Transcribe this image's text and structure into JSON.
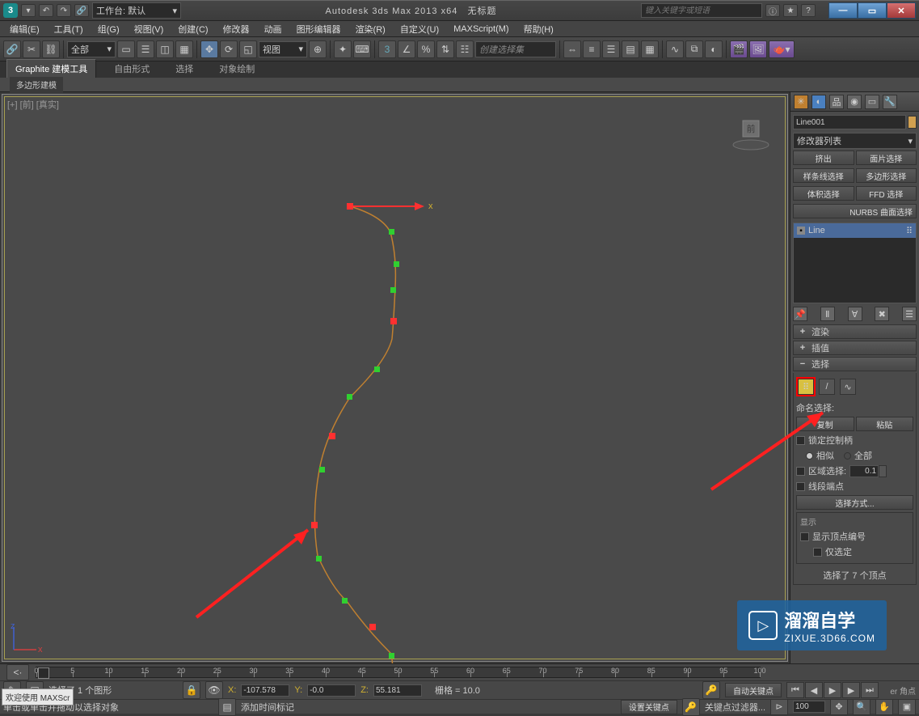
{
  "titlebar": {
    "app_title": "Autodesk 3ds Max  2013 x64",
    "document": "无标题",
    "search_placeholder": "键入关键字或短语",
    "workspace_label": "工作台: 默认"
  },
  "menu": {
    "edit": "编辑(E)",
    "tools": "工具(T)",
    "group": "组(G)",
    "view": "视图(V)",
    "create": "创建(C)",
    "modifiers": "修改器",
    "anim": "动画",
    "graph": "图形编辑器",
    "render": "渲染(R)",
    "custom": "自定义(U)",
    "maxscript": "MAXScript(M)",
    "help": "帮助(H)"
  },
  "toolbar": {
    "all_label": "全部",
    "view_label": "视图",
    "create_set": "创建选择集"
  },
  "ribbon": {
    "tab_graphite": "Graphite 建模工具",
    "tab_free": "自由形式",
    "tab_select": "选择",
    "tab_paint": "对象绘制",
    "sub_poly": "多边形建模"
  },
  "viewport": {
    "label": "[+] [前] [真实]",
    "axis_x": "x",
    "gizmo_x": "x",
    "gizmo_z": "z",
    "cube": "前"
  },
  "side": {
    "object_name": "Line001",
    "modifier_list": "修改器列表",
    "btn_extrude": "挤出",
    "btn_face": "面片选择",
    "btn_spline": "样条线选择",
    "btn_poly": "多边形选择",
    "btn_vol": "体积选择",
    "btn_ffd": "FFD 选择",
    "btn_nurbs": "NURBS 曲面选择",
    "stack_line": "Line",
    "rollout_render": "渲染",
    "rollout_interp": "插值",
    "rollout_select": "选择",
    "named_sel": "命名选择:",
    "btn_copy": "复制",
    "btn_paste": "粘贴",
    "lock_handles": "锁定控制柄",
    "similar": "相似",
    "all": "全部",
    "region_sel": "区域选择:",
    "region_val": "0.1",
    "seg_end": "线段端点",
    "select_by": "选择方式...",
    "display": "显示",
    "show_vtx": "显示顶点编号",
    "sel_only": "仅选定",
    "selected_count": "选择了 7 个顶点",
    "bezier": "er 角点"
  },
  "status": {
    "sel_text": "选择了 1 个图形",
    "prompt": "单击或单击并拖动以选择对象",
    "x": "-107.578",
    "y": "-0.0",
    "z": "55.181",
    "grid": "栅格 = 10.0",
    "auto_key": "自动关键点",
    "set_key": "设置关键点",
    "key_filter": "关键点过滤器...",
    "add_time": "添加时间标记",
    "frame": "100",
    "welcome": "欢迎使用  MAXScr"
  },
  "timeline": {
    "ticks": [
      "0",
      "5",
      "10",
      "15",
      "20",
      "25",
      "30",
      "35",
      "40",
      "45",
      "50",
      "55",
      "60",
      "65",
      "70",
      "75",
      "80",
      "85",
      "90",
      "95",
      "100"
    ]
  },
  "watermark": {
    "brand": "溜溜自学",
    "url": "ZIXUE.3D66.COM"
  }
}
